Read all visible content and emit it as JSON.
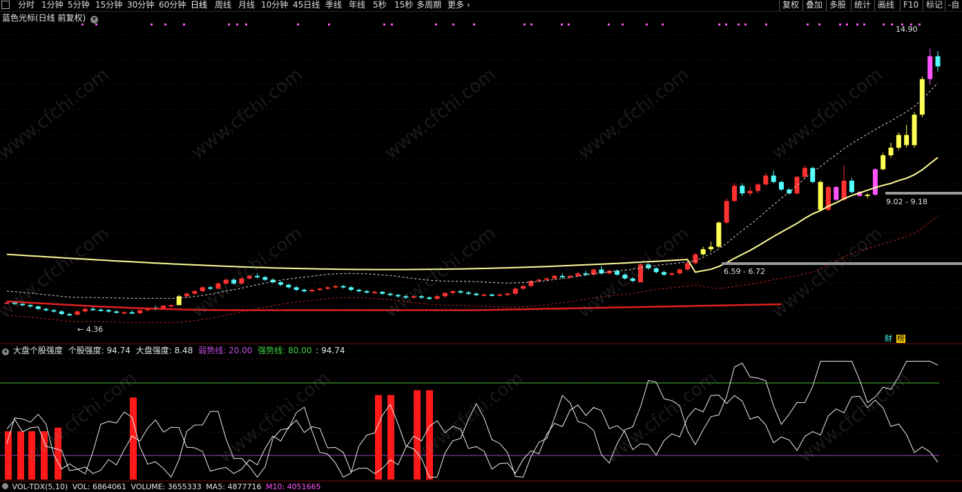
{
  "toolbar": {
    "periods": [
      "分时",
      "1分钟",
      "5分钟",
      "15分钟",
      "30分钟",
      "60分钟",
      "日线",
      "周线",
      "月线",
      "10分钟",
      "45日线",
      "季线",
      "年线",
      "5秒",
      "15秒",
      "多周期",
      "更多"
    ],
    "active_period": "日线",
    "right_buttons": [
      "复权",
      "叠加",
      "多股",
      "统计",
      "画线",
      "F10",
      "标记",
      "-自"
    ]
  },
  "main_panel": {
    "title": "蓝色光标(日线 前复权)",
    "price_high_label": "14.90",
    "price_low_label": "4.36",
    "band_label_1": "9.02 - 9.18",
    "band_label_2": "6.59 - 6.72",
    "badges": [
      "财",
      "榜"
    ]
  },
  "indicator_panel": {
    "title": "大盘个股强度",
    "stock_strength_label": "个股强度:",
    "stock_strength_value": "94.74",
    "market_strength_label": "大盘强度:",
    "market_strength_value": "8.48",
    "weak_line_label": "弱势线:",
    "weak_line_value": "20.00",
    "strong_line_label": "强势线:",
    "strong_line_value": "80.00",
    "last_value": ": 94.74"
  },
  "volume_panel": {
    "title": "VOL-TDX(5,10)",
    "vol": "VOL: 6864061",
    "volume": "VOLUME: 3655333",
    "ma5": "MA5: 4877716",
    "ma10": "M10: 4051665"
  },
  "watermark": "www.cfchi.com",
  "colors": {
    "up": "#ff3232",
    "down": "#54ffff",
    "yellow": "#ffff54",
    "magenta": "#ff54ff",
    "ma_line": "#ffff99",
    "weak_line": "#a040c0",
    "strong_line": "#40c040"
  },
  "chart_data": {
    "type": "candlestick",
    "ylim": [
      3.5,
      16
    ],
    "candles": [
      [
        4.9,
        4.95,
        4.85,
        4.9
      ],
      [
        4.9,
        4.92,
        4.8,
        4.85
      ],
      [
        4.85,
        4.88,
        4.75,
        4.8
      ],
      [
        4.8,
        4.85,
        4.7,
        4.75
      ],
      [
        4.75,
        4.78,
        4.6,
        4.65
      ],
      [
        4.65,
        4.7,
        4.55,
        4.6
      ],
      [
        4.6,
        4.65,
        4.5,
        4.55
      ],
      [
        4.55,
        4.6,
        4.4,
        4.45
      ],
      [
        4.45,
        4.5,
        4.36,
        4.42
      ],
      [
        4.42,
        4.6,
        4.4,
        4.55
      ],
      [
        4.55,
        4.7,
        4.5,
        4.65
      ],
      [
        4.65,
        4.75,
        4.6,
        4.62
      ],
      [
        4.62,
        4.68,
        4.55,
        4.6
      ],
      [
        4.6,
        4.65,
        4.5,
        4.55
      ],
      [
        4.55,
        4.6,
        4.48,
        4.5
      ],
      [
        4.5,
        4.55,
        4.45,
        4.52
      ],
      [
        4.52,
        4.6,
        4.45,
        4.48
      ],
      [
        4.48,
        4.62,
        4.45,
        4.6
      ],
      [
        4.6,
        4.72,
        4.55,
        4.7
      ],
      [
        4.7,
        4.78,
        4.6,
        4.62
      ],
      [
        4.62,
        4.8,
        4.6,
        4.78
      ],
      [
        4.78,
        4.82,
        4.7,
        4.8
      ],
      [
        4.8,
        5.2,
        4.8,
        5.15
      ],
      [
        5.15,
        5.3,
        5.1,
        5.25
      ],
      [
        5.25,
        5.4,
        5.2,
        5.35
      ],
      [
        5.35,
        5.55,
        5.3,
        5.5
      ],
      [
        5.5,
        5.55,
        5.4,
        5.45
      ],
      [
        5.45,
        5.7,
        5.42,
        5.65
      ],
      [
        5.65,
        5.85,
        5.6,
        5.8
      ],
      [
        5.8,
        5.85,
        5.6,
        5.65
      ],
      [
        5.65,
        5.9,
        5.6,
        5.85
      ],
      [
        5.85,
        6.0,
        5.8,
        5.95
      ],
      [
        5.95,
        6.05,
        5.85,
        5.9
      ],
      [
        5.9,
        5.95,
        5.75,
        5.8
      ],
      [
        5.8,
        5.85,
        5.65,
        5.7
      ],
      [
        5.7,
        5.75,
        5.55,
        5.6
      ],
      [
        5.6,
        5.65,
        5.45,
        5.5
      ],
      [
        5.5,
        5.55,
        5.35,
        5.4
      ],
      [
        5.4,
        5.45,
        5.3,
        5.35
      ],
      [
        5.35,
        5.45,
        5.3,
        5.4
      ],
      [
        5.4,
        5.5,
        5.35,
        5.45
      ],
      [
        5.45,
        5.55,
        5.4,
        5.5
      ],
      [
        5.5,
        5.6,
        5.45,
        5.55
      ],
      [
        5.55,
        5.6,
        5.45,
        5.5
      ],
      [
        5.5,
        5.55,
        5.35,
        5.4
      ],
      [
        5.4,
        5.45,
        5.3,
        5.35
      ],
      [
        5.35,
        5.4,
        5.25,
        5.3
      ],
      [
        5.3,
        5.38,
        5.25,
        5.32
      ],
      [
        5.32,
        5.36,
        5.2,
        5.25
      ],
      [
        5.25,
        5.3,
        5.15,
        5.2
      ],
      [
        5.2,
        5.25,
        5.1,
        5.15
      ],
      [
        5.15,
        5.2,
        5.05,
        5.1
      ],
      [
        5.1,
        5.18,
        5.05,
        5.15
      ],
      [
        5.15,
        5.2,
        5.05,
        5.1
      ],
      [
        5.1,
        5.15,
        5.0,
        5.05
      ],
      [
        5.05,
        5.2,
        5.0,
        5.15
      ],
      [
        5.15,
        5.3,
        5.1,
        5.28
      ],
      [
        5.28,
        5.38,
        5.2,
        5.35
      ],
      [
        5.35,
        5.4,
        5.25,
        5.3
      ],
      [
        5.3,
        5.35,
        5.2,
        5.25
      ],
      [
        5.25,
        5.3,
        5.15,
        5.2
      ],
      [
        5.2,
        5.25,
        5.15,
        5.22
      ],
      [
        5.22,
        5.25,
        5.15,
        5.18
      ],
      [
        5.18,
        5.25,
        5.15,
        5.22
      ],
      [
        5.22,
        5.3,
        5.18,
        5.25
      ],
      [
        5.25,
        5.5,
        5.2,
        5.45
      ],
      [
        5.45,
        5.6,
        5.4,
        5.55
      ],
      [
        5.55,
        5.8,
        5.5,
        5.75
      ],
      [
        5.75,
        5.85,
        5.7,
        5.8
      ],
      [
        5.8,
        5.9,
        5.75,
        5.85
      ],
      [
        5.85,
        6.0,
        5.8,
        5.95
      ],
      [
        5.95,
        6.05,
        5.85,
        5.9
      ],
      [
        5.9,
        6.0,
        5.85,
        5.95
      ],
      [
        5.95,
        6.1,
        5.9,
        6.05
      ],
      [
        6.05,
        6.15,
        5.95,
        6.0
      ],
      [
        6.0,
        6.25,
        5.95,
        6.2
      ],
      [
        6.2,
        6.35,
        6.0,
        6.05
      ],
      [
        6.05,
        6.2,
        6.0,
        6.15
      ],
      [
        6.15,
        6.2,
        5.95,
        6.0
      ],
      [
        6.0,
        6.05,
        5.8,
        5.85
      ],
      [
        5.85,
        5.9,
        5.7,
        5.75
      ],
      [
        5.7,
        6.45,
        5.7,
        6.4
      ],
      [
        6.4,
        6.45,
        6.2,
        6.25
      ],
      [
        6.25,
        6.3,
        6.05,
        6.1
      ],
      [
        6.1,
        6.15,
        5.95,
        6.0
      ],
      [
        6.0,
        6.1,
        5.95,
        6.05
      ],
      [
        6.05,
        6.25,
        6.0,
        6.2
      ],
      [
        6.2,
        6.5,
        6.15,
        6.45
      ],
      [
        6.45,
        6.85,
        6.4,
        6.8
      ],
      [
        6.8,
        7.1,
        6.75,
        7.0
      ],
      [
        7.0,
        7.3,
        6.9,
        7.1
      ],
      [
        7.1,
        8.1,
        7.05,
        8.05
      ],
      [
        8.05,
        9.0,
        8.0,
        8.9
      ],
      [
        8.9,
        9.6,
        8.85,
        9.5
      ],
      [
        9.5,
        9.6,
        9.1,
        9.2
      ],
      [
        9.2,
        9.45,
        9.1,
        9.3
      ],
      [
        9.3,
        9.6,
        9.2,
        9.55
      ],
      [
        9.55,
        10.0,
        9.5,
        9.9
      ],
      [
        9.9,
        10.1,
        9.6,
        9.65
      ],
      [
        9.65,
        9.7,
        9.3,
        9.35
      ],
      [
        9.35,
        9.4,
        9.15,
        9.2
      ],
      [
        9.2,
        9.9,
        9.15,
        9.85
      ],
      [
        9.85,
        10.3,
        9.8,
        10.2
      ],
      [
        10.2,
        10.25,
        9.6,
        9.65
      ],
      [
        9.65,
        9.7,
        8.5,
        8.55
      ],
      [
        8.55,
        9.5,
        8.5,
        9.45
      ],
      [
        9.45,
        9.5,
        8.9,
        8.95
      ],
      [
        8.95,
        10.3,
        8.9,
        9.7
      ],
      [
        9.7,
        9.8,
        9.2,
        9.25
      ],
      [
        9.25,
        9.3,
        9.05,
        9.1
      ],
      [
        9.1,
        9.2,
        9.0,
        9.15
      ],
      [
        9.15,
        10.2,
        9.1,
        10.15
      ],
      [
        10.15,
        10.8,
        10.1,
        10.7
      ],
      [
        10.7,
        11.2,
        10.6,
        11.0
      ],
      [
        11.0,
        11.6,
        10.9,
        11.5
      ],
      [
        11.5,
        11.9,
        11.0,
        11.1
      ],
      [
        11.1,
        12.4,
        11.0,
        12.3
      ],
      [
        12.3,
        13.8,
        12.2,
        13.7
      ],
      [
        13.7,
        14.9,
        13.5,
        14.6
      ],
      [
        14.6,
        14.8,
        14.0,
        14.2
      ]
    ],
    "candle_colors": "u=up red, d=down cyan, y=limit-up yellow, m=magenta"
  }
}
